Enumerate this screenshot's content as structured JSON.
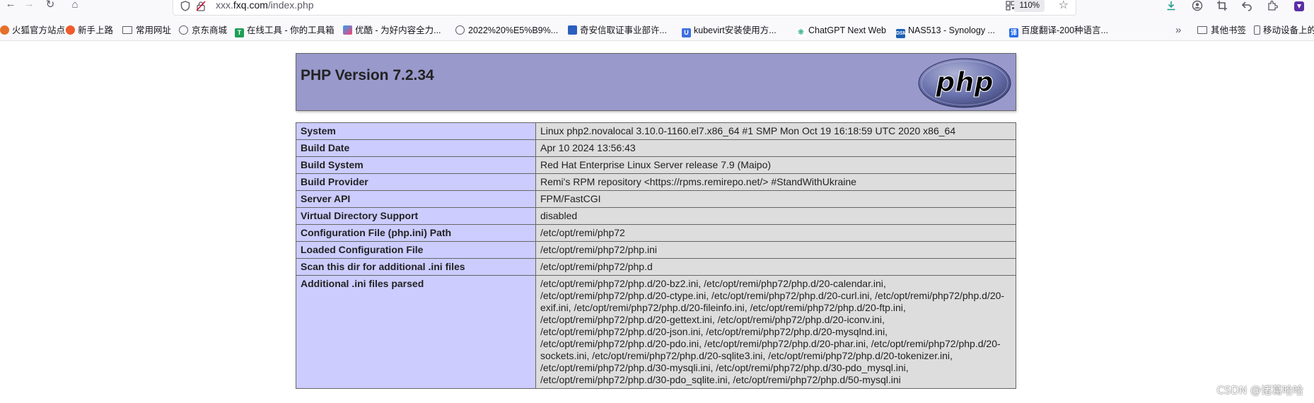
{
  "browser": {
    "url_prefix": "xxx.",
    "url_host": "fxq.com",
    "url_path": "/index.php",
    "zoom": "110%",
    "icons": [
      "back-icon",
      "forward-icon",
      "reload-icon",
      "home-icon",
      "shield-icon",
      "lock-icon",
      "qr-code-icon",
      "star-icon",
      "download-icon",
      "account-icon",
      "crop-icon",
      "undo-icon",
      "extensions-icon",
      "bookmark-chevron-icon"
    ]
  },
  "bookmarks": {
    "items": [
      {
        "label": "火狐官方站点",
        "icon": "firefox-icon"
      },
      {
        "label": "新手上路",
        "icon": "firefox-icon"
      },
      {
        "label": "常用网址",
        "icon": "folder-icon"
      },
      {
        "label": "京东商城",
        "icon": "globe-icon"
      },
      {
        "label": "在线工具 - 你的工具箱",
        "icon": "tool-icon"
      },
      {
        "label": "优酷 - 为好内容全力...",
        "icon": "youku-icon"
      },
      {
        "label": "2022%20%E5%B9%...",
        "icon": "globe-icon"
      },
      {
        "label": "奇安信取证事业部许...",
        "icon": "qianxin-icon"
      },
      {
        "label": "kubevirt安装使用方...",
        "icon": "u-icon"
      },
      {
        "label": "ChatGPT Next Web",
        "icon": "chatgpt-icon"
      },
      {
        "label": "NAS513 - Synology ...",
        "icon": "dsm-icon"
      },
      {
        "label": "百度翻译-200种语言...",
        "icon": "baidu-translate-icon"
      }
    ],
    "overflow": "»",
    "other": "其他书签",
    "mobile": "移动设备上的"
  },
  "phpinfo": {
    "title": "PHP Version 7.2.34",
    "logo_text": "php",
    "rows": [
      {
        "key": "System",
        "value": "Linux php2.novalocal 3.10.0-1160.el7.x86_64 #1 SMP Mon Oct 19 16:18:59 UTC 2020 x86_64"
      },
      {
        "key": "Build Date",
        "value": "Apr 10 2024 13:56:43"
      },
      {
        "key": "Build System",
        "value": "Red Hat Enterprise Linux Server release 7.9 (Maipo)"
      },
      {
        "key": "Build Provider",
        "value": "Remi's RPM repository <https://rpms.remirepo.net/> #StandWithUkraine"
      },
      {
        "key": "Server API",
        "value": "FPM/FastCGI"
      },
      {
        "key": "Virtual Directory Support",
        "value": "disabled"
      },
      {
        "key": "Configuration File (php.ini) Path",
        "value": "/etc/opt/remi/php72"
      },
      {
        "key": "Loaded Configuration File",
        "value": "/etc/opt/remi/php72/php.ini"
      },
      {
        "key": "Scan this dir for additional .ini files",
        "value": "/etc/opt/remi/php72/php.d"
      },
      {
        "key": "Additional .ini files parsed",
        "value": "/etc/opt/remi/php72/php.d/20-bz2.ini, /etc/opt/remi/php72/php.d/20-calendar.ini, /etc/opt/remi/php72/php.d/20-ctype.ini, /etc/opt/remi/php72/php.d/20-curl.ini, /etc/opt/remi/php72/php.d/20-exif.ini, /etc/opt/remi/php72/php.d/20-fileinfo.ini, /etc/opt/remi/php72/php.d/20-ftp.ini, /etc/opt/remi/php72/php.d/20-gettext.ini, /etc/opt/remi/php72/php.d/20-iconv.ini, /etc/opt/remi/php72/php.d/20-json.ini, /etc/opt/remi/php72/php.d/20-mysqlnd.ini, /etc/opt/remi/php72/php.d/20-pdo.ini, /etc/opt/remi/php72/php.d/20-phar.ini, /etc/opt/remi/php72/php.d/20-sockets.ini, /etc/opt/remi/php72/php.d/20-sqlite3.ini, /etc/opt/remi/php72/php.d/20-tokenizer.ini, /etc/opt/remi/php72/php.d/30-mysqli.ini, /etc/opt/remi/php72/php.d/30-pdo_mysql.ini, /etc/opt/remi/php72/php.d/30-pdo_sqlite.ini, /etc/opt/remi/php72/php.d/50-mysql.ini"
      }
    ]
  },
  "watermark": "CSDN @诸葛哈哈",
  "colors": {
    "header_bg": "#9999cc",
    "key_bg": "#ccccff",
    "value_bg": "#dddddd",
    "border": "#666666"
  }
}
